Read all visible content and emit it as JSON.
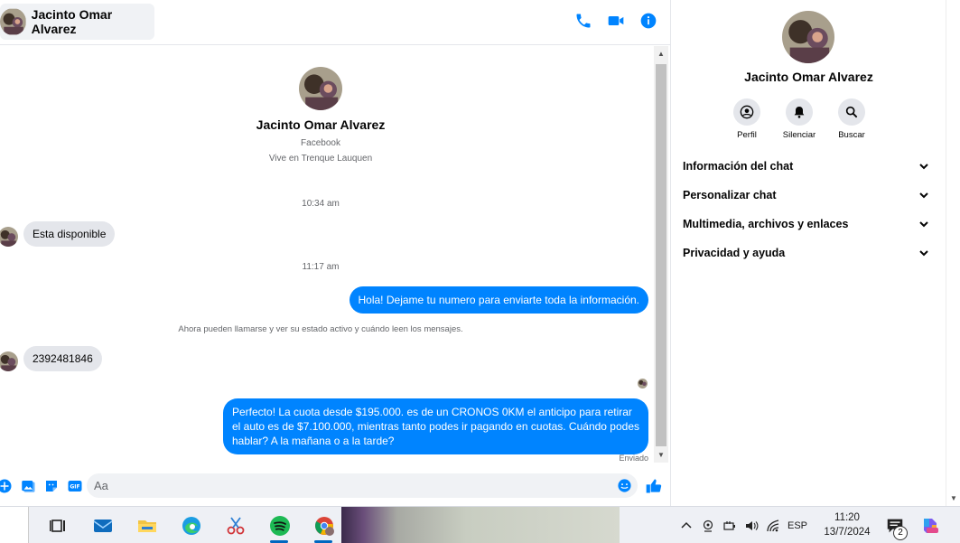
{
  "header": {
    "contact_name": "Jacinto Omar Alvarez",
    "icons": [
      "phone-icon",
      "video-call-icon",
      "info-icon"
    ]
  },
  "intro": {
    "name": "Jacinto Omar Alvarez",
    "platform": "Facebook",
    "location": "Vive en Trenque Lauquen"
  },
  "conversation": {
    "time_1": "10:34 am",
    "msg_in_1": "Esta disponible",
    "time_2": "11:17 am",
    "msg_out_1": "Hola! Dejame tu numero  para enviarte toda la información.",
    "system_note": "Ahora pueden llamarse y ver su estado activo y cuándo leen los mensajes.",
    "msg_in_2": "2392481846",
    "msg_out_2": "Perfecto! La cuota desde $195.000. es de un CRONOS 0KM el anticipo para retirar el auto es de $7.100.000, mientras tanto podes ir pagando en cuotas. Cuándo podes hablar? A la mañana o a la tarde?",
    "status": "Enviado"
  },
  "composer": {
    "placeholder": "Aa",
    "tools": [
      "plus-icon",
      "photo-icon",
      "sticker-icon",
      "gif-icon"
    ],
    "gif_label": "GIF"
  },
  "right_panel": {
    "name": "Jacinto Omar Alvarez",
    "actions": [
      {
        "label": "Perfil",
        "icon": "profile-icon"
      },
      {
        "label": "Silenciar",
        "icon": "bell-icon"
      },
      {
        "label": "Buscar",
        "icon": "search-icon"
      }
    ],
    "sections": [
      "Información del chat",
      "Personalizar chat",
      "Multimedia, archivos y enlaces",
      "Privacidad y ayuda"
    ]
  },
  "taskbar": {
    "apps": [
      "task-view-icon",
      "mail-icon",
      "file-explorer-icon",
      "edge-icon",
      "snipping-tool-icon",
      "spotify-icon",
      "chrome-icon"
    ],
    "language": "ESP",
    "time": "11:20",
    "date": "13/7/2024",
    "notification_count": "2",
    "colors": {
      "accent": "#0067c0",
      "messenger_blue": "#0084ff"
    }
  }
}
